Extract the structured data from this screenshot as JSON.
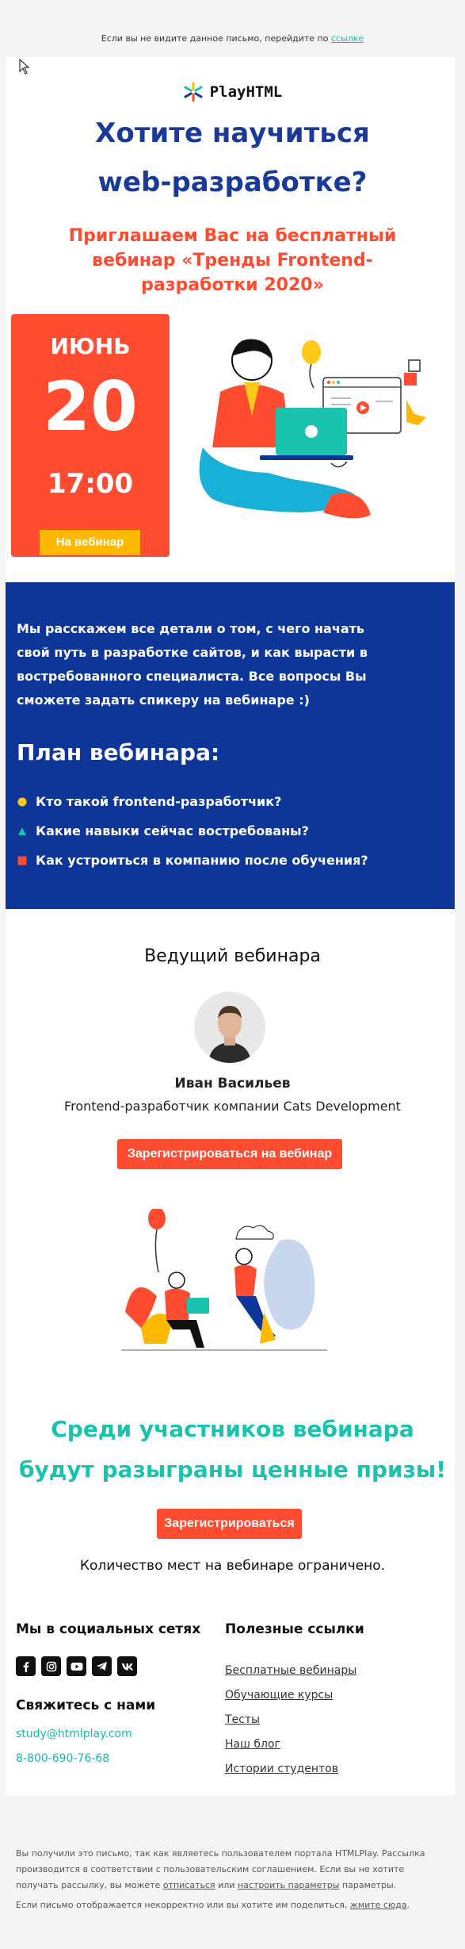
{
  "preheader": {
    "text": "Если вы не видите данное письмо, перейдите по ",
    "link": "ссылке"
  },
  "logo": {
    "name": "PlayHTML",
    "icon": "spark-logo-icon"
  },
  "headline": {
    "line1": "Хотите научиться",
    "line2": "web-разработке?"
  },
  "invite": "Приглашаем Вас на бесплатный вебинар «Тренды Frontend-разработки 2020»",
  "date_card": {
    "month": "июнь",
    "day": "20",
    "time": "17:00",
    "button": "На вебинар"
  },
  "about": {
    "text": "Мы расскажем все детали о том, с чего начать свой путь в разработке сайтов, и как вырасти в востребованного специалиста. Все вопросы Вы сможете задать спикеру на вебинаре :)",
    "plan_title": "План вебинара:",
    "plan_items": [
      {
        "text": "Кто такой frontend-разработчик?",
        "bullet": "circle",
        "color": "#ffc91a"
      },
      {
        "text": "Какие навыки сейчас востребованы?",
        "bullet": "triangle",
        "color": "#19c3ad"
      },
      {
        "text": "Как устроиться в компанию после обучения?",
        "bullet": "square",
        "color": "#ff4b30"
      }
    ]
  },
  "host": {
    "title": "Ведущий вебинара",
    "name": "Иван Васильев",
    "role": "Frontend-разработчик компании Cats Development",
    "register_button": "Зарегистрироваться на вебинар"
  },
  "prize": {
    "text": "Среди участников вебинара будут разыграны ценные призы!",
    "register_button": "Зарегистрироваться",
    "limit": "Количество мест на вебинаре ограничено."
  },
  "footer": {
    "social_title": "Мы в социальных сетях",
    "social_icons": [
      "facebook-icon",
      "instagram-icon",
      "youtube-icon",
      "telegram-icon",
      "vk-icon"
    ],
    "contact_title": "Свяжитесь с нами",
    "email": "study@htmlplay.com",
    "phone": "8-800-690-76-68",
    "links_title": "Полезные ссылки",
    "links": [
      "Бесплатные вебинары",
      "Обучающие курсы",
      "Тесты",
      "Наш блог",
      "Истории студентов"
    ]
  },
  "legal": {
    "p1_a": "Вы получили это письмо, так как являетесь пользователем портала HTMLPlay. Рассылка производится в соответствии с пользовательским соглашением. Если вы не хотите получать рассылку, вы можете ",
    "unsubscribe": "отписаться",
    "p1_b": " или ",
    "settings": "настроить параметры",
    "p1_c": " параметры.",
    "p2_a": "Если письмо отображается некорректно или вы хотите им поделиться, ",
    "p2_link": "жмите сюда",
    "p2_b": "."
  },
  "colors": {
    "primary_blue": "#0e3598",
    "accent_red": "#ff4b30",
    "accent_teal": "#19c3ad",
    "accent_yellow": "#ffb800"
  }
}
